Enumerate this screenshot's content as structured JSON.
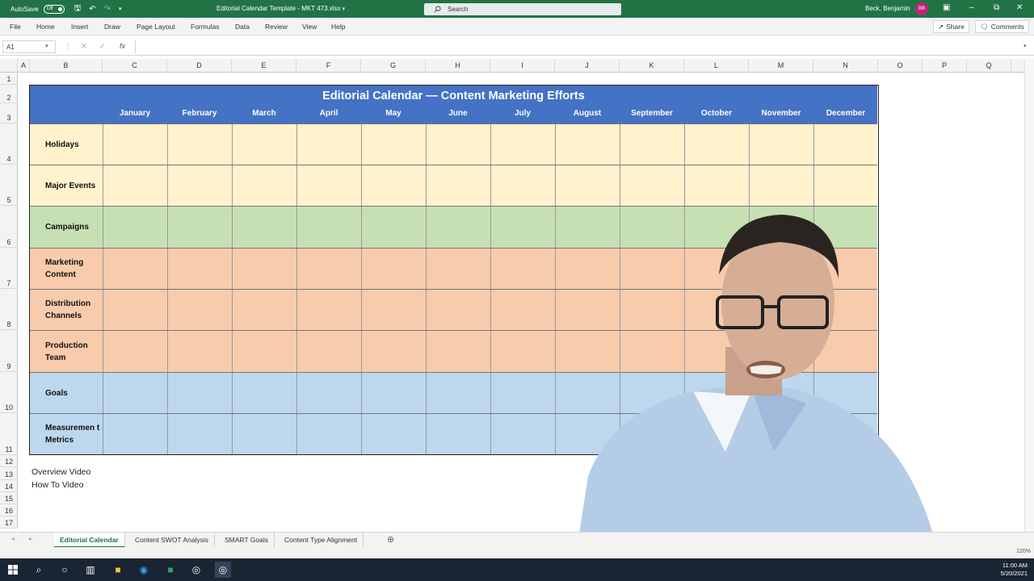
{
  "titlebar": {
    "autosave_label": "AutoSave",
    "autosave_state": "Off",
    "document_title": "Editorial Calendar Template - MKT 473.xlsx",
    "search_placeholder": "Search",
    "user_name": "Beck, Benjamin",
    "user_initials": "BB"
  },
  "ribbon": {
    "tabs": [
      "File",
      "Home",
      "Insert",
      "Draw",
      "Page Layout",
      "Formulas",
      "Data",
      "Review",
      "View",
      "Help"
    ],
    "share_label": "Share",
    "comments_label": "Comments"
  },
  "formula_bar": {
    "name_box": "A1",
    "fx": "fx",
    "value": ""
  },
  "columns": [
    "A",
    "B",
    "C",
    "D",
    "E",
    "F",
    "G",
    "H",
    "I",
    "J",
    "K",
    "L",
    "M",
    "N",
    "O",
    "P",
    "Q"
  ],
  "rows": [
    "1",
    "2",
    "3",
    "4",
    "5",
    "6",
    "7",
    "8",
    "9",
    "10",
    "11",
    "12",
    "13",
    "14",
    "15",
    "16",
    "17"
  ],
  "calendar": {
    "title": "Editorial Calendar — Content Marketing Efforts",
    "months": [
      "January",
      "February",
      "March",
      "April",
      "May",
      "June",
      "July",
      "August",
      "September",
      "October",
      "November",
      "December"
    ],
    "row_labels": [
      "Holidays",
      "Major Events",
      "Campaigns",
      "Marketing Content",
      "Distribution Channels",
      "Production Team",
      "Goals",
      "Measuremen t Metrics"
    ],
    "colors": {
      "header": "#4472c4",
      "yellow": "#fff2cc",
      "green": "#c6e0b4",
      "orange": "#f8cbad",
      "blue": "#bdd7ee"
    }
  },
  "notes": {
    "overview": "Overview Video",
    "howto": "How To Video"
  },
  "sheet_tabs": [
    "Editorial Calendar",
    "Content SWOT Analysis",
    "SMART Goals",
    "Content Type Alignment"
  ],
  "status": {
    "zoom": "120%"
  },
  "taskbar": {
    "time": "11:00 AM",
    "date": "5/20/2021"
  }
}
